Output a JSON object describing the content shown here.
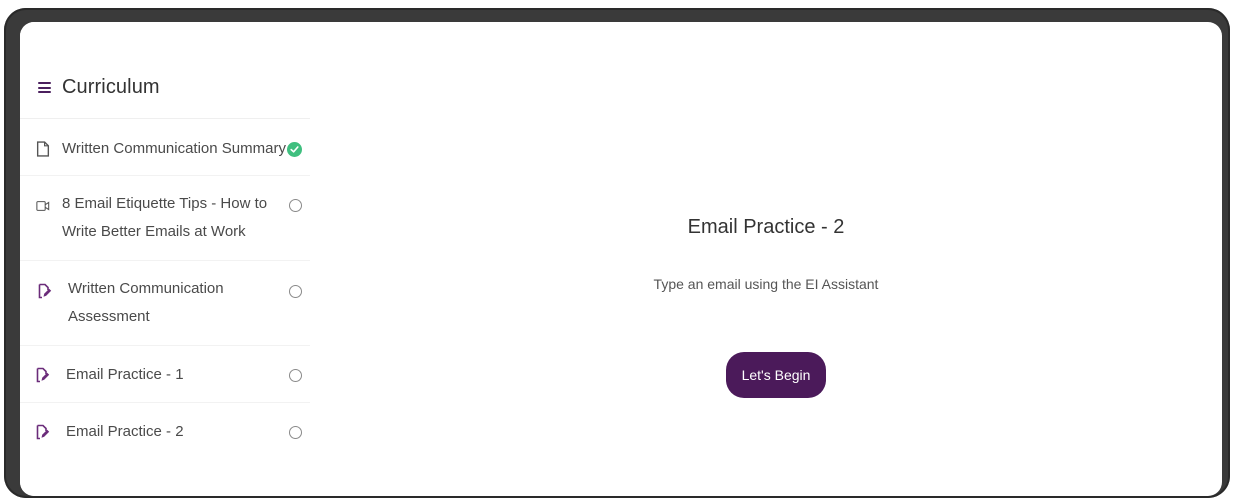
{
  "sidebar": {
    "title": "Curriculum",
    "items": [
      {
        "label": "Written Communication Summary",
        "icon": "document-icon",
        "status": "completed"
      },
      {
        "label_line1": "8 Email Etiquette Tips - How to",
        "label_line2": "Write Better Emails at Work",
        "icon": "video-icon",
        "status": "incomplete"
      },
      {
        "label_line1": "Written Communication",
        "label_line2": "Assessment",
        "icon": "edit-document-icon",
        "status": "incomplete"
      },
      {
        "label": "Email Practice - 1",
        "icon": "edit-document-icon",
        "status": "incomplete"
      },
      {
        "label": "Email Practice - 2",
        "icon": "edit-document-icon",
        "status": "incomplete"
      }
    ]
  },
  "main": {
    "title": "Email Practice - 2",
    "subtitle": "Type an email using the EI Assistant",
    "begin_label": "Let's Begin"
  },
  "colors": {
    "accent": "#4b1a5a",
    "success": "#3fbf7f",
    "frame": "#3a3a3a"
  }
}
